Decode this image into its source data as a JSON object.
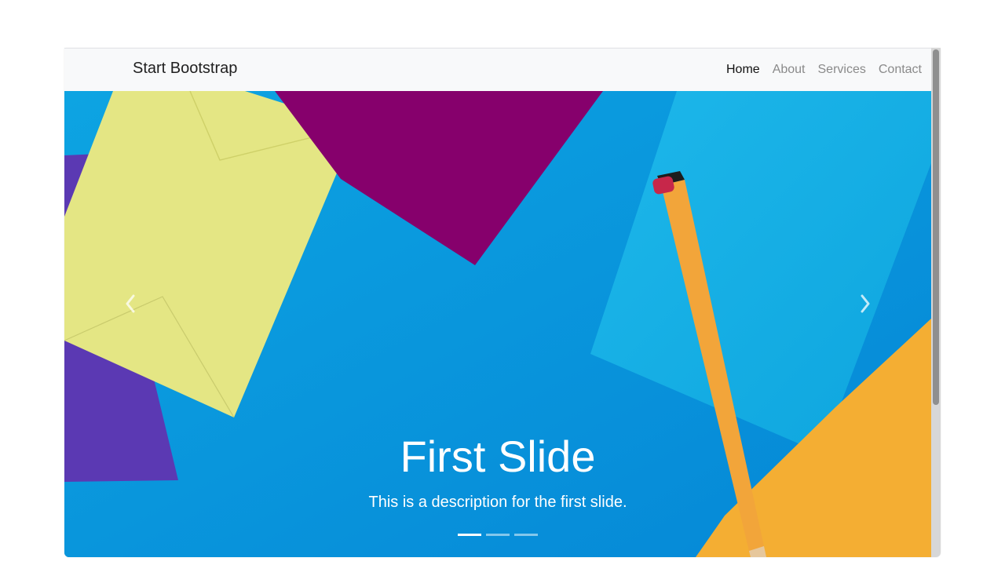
{
  "navbar": {
    "brand": "Start Bootstrap",
    "links": [
      {
        "label": "Home",
        "active": true
      },
      {
        "label": "About",
        "active": false
      },
      {
        "label": "Services",
        "active": false
      },
      {
        "label": "Contact",
        "active": false
      }
    ]
  },
  "carousel": {
    "title": "First Slide",
    "description": "This is a description for the first slide.",
    "slide_count": 3,
    "active_index": 0,
    "controls": {
      "prev_icon": "chevron-left-icon",
      "next_icon": "chevron-right-icon"
    }
  },
  "colors": {
    "hero_blue": "#0b98dc",
    "yellow_envelope": "#e4e684",
    "purple_envelope": "#5b39b3",
    "magenta_envelope": "#86006c",
    "orange_envelope": "#f4ae33",
    "pencil": "#f2a53a"
  }
}
